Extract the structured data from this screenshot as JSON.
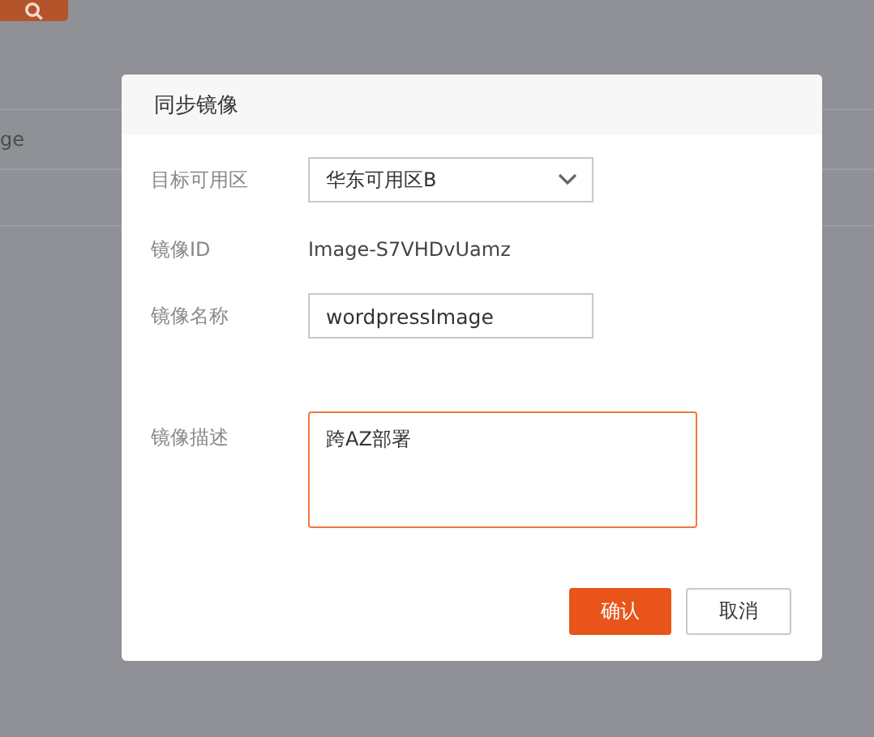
{
  "background": {
    "row_text": "ge"
  },
  "dialog": {
    "title": "同步镜像",
    "fields": [
      {
        "kind": "select",
        "label": "目标可用区",
        "value": "华东可用区B"
      },
      {
        "kind": "text",
        "label": "镜像ID",
        "value": "Image-S7VHDvUamz"
      },
      {
        "kind": "input",
        "label": "镜像名称",
        "value": "wordpressImage"
      },
      {
        "kind": "textarea",
        "label": "镜像描述",
        "value": "跨AZ部署"
      }
    ],
    "buttons": [
      {
        "label": "确认",
        "kind": "primary"
      },
      {
        "label": "取消",
        "kind": "default"
      }
    ]
  }
}
